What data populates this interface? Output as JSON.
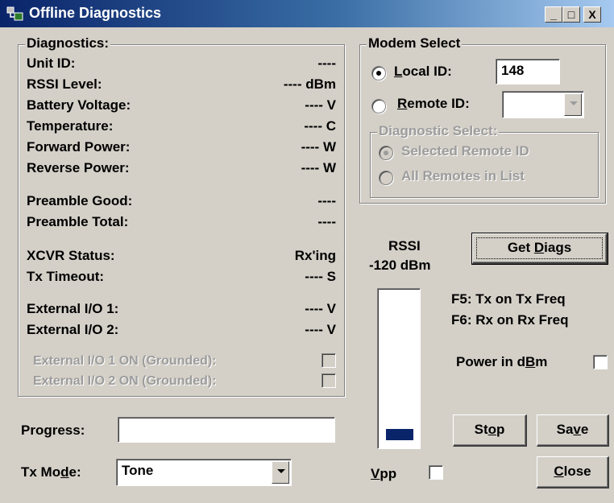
{
  "window": {
    "title": "Offline Diagnostics",
    "controls": {
      "minimize": "_",
      "maximize": "□",
      "close": "X"
    }
  },
  "diagnostics": {
    "group_title": "Diagnostics:",
    "rows": [
      {
        "label": "Unit ID:",
        "value": "----"
      },
      {
        "label": "RSSI Level:",
        "value": "---- dBm"
      },
      {
        "label": "Battery Voltage:",
        "value": "---- V"
      },
      {
        "label": "Temperature:",
        "value": "---- C"
      },
      {
        "label": "Forward Power:",
        "value": "---- W"
      },
      {
        "label": "Reverse Power:",
        "value": "---- W"
      },
      {
        "label": "Preamble Good:",
        "value": "----"
      },
      {
        "label": "Preamble Total:",
        "value": "----"
      },
      {
        "label": "XCVR Status:",
        "value": "Rx'ing"
      },
      {
        "label": "Tx Timeout:",
        "value": "---- S"
      },
      {
        "label": "External I/O 1:",
        "value": "---- V"
      },
      {
        "label": "External I/O 2:",
        "value": "---- V"
      }
    ],
    "io1_on_label": "External I/O 1 ON (Grounded):",
    "io2_on_label": "External I/O 2 ON (Grounded):",
    "io1_on_checked": false,
    "io2_on_checked": false
  },
  "modem_select": {
    "group_title": "Modem Select",
    "local_id_label": "ocal ID:",
    "local_id_mnemonic": "L",
    "local_id_value": "148",
    "local_id_selected": true,
    "remote_id_label": "emote ID:",
    "remote_id_mnemonic": "R",
    "remote_id_value": "",
    "diagnostic_select": {
      "group_title": "Diagnostic Select:",
      "options": [
        "Selected Remote ID",
        "All Remotes in List"
      ],
      "selected": "Selected Remote ID"
    }
  },
  "rssi": {
    "label": "RSSI",
    "value_text": "-120 dBm",
    "meter_fraction": 0.08,
    "meter_color": "#0a246a"
  },
  "buttons": {
    "get_diags_pre": "Get ",
    "get_diags_mnemonic": "D",
    "get_diags_post": "iags",
    "stop_pre": "St",
    "stop_mnemonic": "o",
    "stop_post": "p",
    "save_pre": "Sa",
    "save_mnemonic": "v",
    "save_post": "e",
    "close_pre": "",
    "close_mnemonic": "C",
    "close_post": "lose"
  },
  "hints": {
    "f5": "F5: Tx on Tx Freq",
    "f6": "F6: Rx on Rx Freq"
  },
  "power_in_dbm": {
    "label_pre": "Power in d",
    "label_mnemonic": "B",
    "label_post": "m",
    "checked": false
  },
  "progress": {
    "label": "Progress:",
    "value": 0
  },
  "tx_mode": {
    "label_pre": "Tx Mo",
    "label_mnemonic": "d",
    "label_post": "e:",
    "value": "Tone"
  },
  "vpp": {
    "label_mnemonic": "V",
    "label_post": "pp",
    "checked": false
  }
}
